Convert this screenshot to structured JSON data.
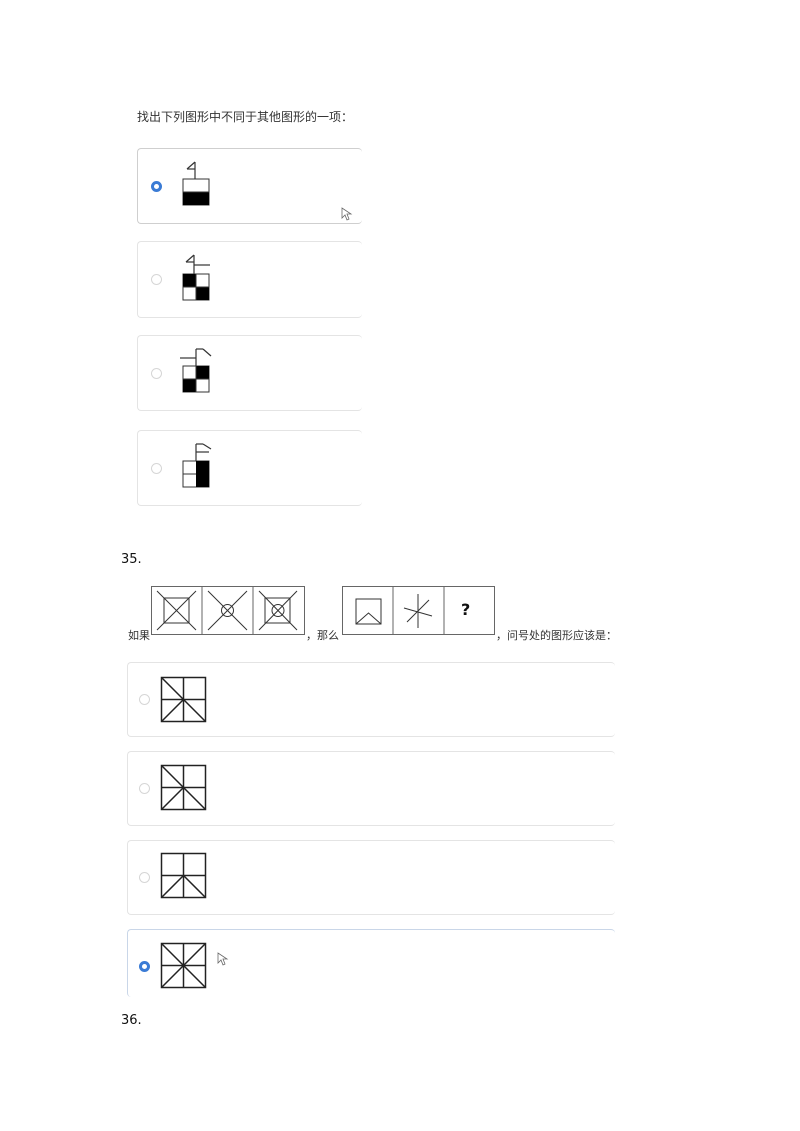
{
  "q34": {
    "prompt": "找出下列图形中不同于其他图形的一项：",
    "options": [
      {
        "selected": true,
        "figure": "flag-square-bottom-black"
      },
      {
        "selected": false,
        "figure": "flag-square-checker-tl-br"
      },
      {
        "selected": false,
        "figure": "flag-square-checker-tr-bl"
      },
      {
        "selected": false,
        "figure": "flag-square-right-black"
      }
    ]
  },
  "q35": {
    "number": "35.",
    "prefix": "如果",
    "middle": "，那么",
    "suffix": "，问号处的图形应该是：",
    "question_mark": "?",
    "options": [
      {
        "selected": false,
        "figure": "grid-with-diagonals-a"
      },
      {
        "selected": false,
        "figure": "grid-with-diagonals-b"
      },
      {
        "selected": false,
        "figure": "grid-with-diagonals-c"
      },
      {
        "selected": true,
        "figure": "grid-with-diagonals-d"
      }
    ]
  },
  "q36": {
    "number": "36."
  },
  "colors": {
    "accent": "#3a7bd5",
    "border": "#e4e4e4"
  }
}
